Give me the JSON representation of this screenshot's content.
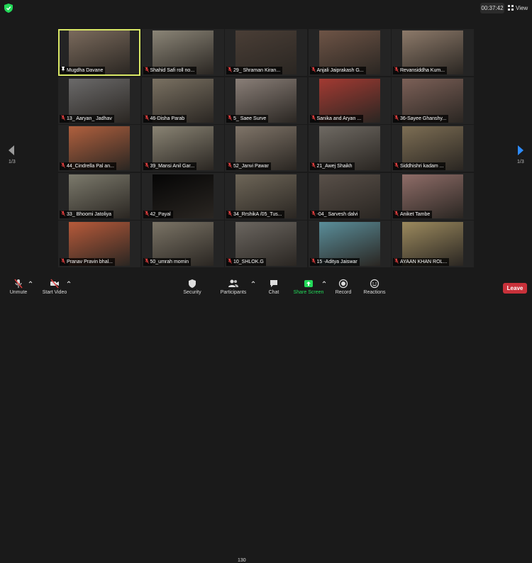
{
  "header": {
    "timer": "00:37:42",
    "view_label": "View"
  },
  "pagination": {
    "left": "1/3",
    "right": "1/3"
  },
  "participants": [
    {
      "name": "Mugdha Davane",
      "pinned": true,
      "active": true,
      "video": "#7a6a5c"
    },
    {
      "name": "Shahid Safi roll no...",
      "video": "#8b8577"
    },
    {
      "name": "29_ Shraman Kiran...",
      "video": "#4a3e36"
    },
    {
      "name": "Anjali Jaiprakash G...",
      "video": "#6e5446"
    },
    {
      "name": "Revansiddha Kum...",
      "video": "#8d7a6a"
    },
    {
      "name": "13_ Aaryan_ Jadhav",
      "video": "#6b6a6a"
    },
    {
      "name": "46-Disha Parab",
      "video": "#7a7162"
    },
    {
      "name": "5_ Saee Surve",
      "video": "#8a7f78"
    },
    {
      "name": "Sanika and  Aryan ...",
      "video": "#a33a32"
    },
    {
      "name": "36-Sayee Ghanshy...",
      "video": "#7c6057"
    },
    {
      "name": "44_Cindrella Pal an...",
      "video": "#b0603e"
    },
    {
      "name": "39_Mansi Anil  Gar...",
      "video": "#8a8474"
    },
    {
      "name": "52_Janvi Pawar",
      "video": "#807569"
    },
    {
      "name": "21_Awej Shaikh",
      "video": "#6f6a63"
    },
    {
      "name": "Siddhishri kadam ...",
      "video": "#7d6e54"
    },
    {
      "name": "33_ Bhoomi Jatoliya",
      "video": "#7c7a6c"
    },
    {
      "name": "42_Payal",
      "video": "#050505"
    },
    {
      "name": "34_RrshikA /05_Tus...",
      "video": "#6e6658"
    },
    {
      "name": "-04_ Sarvesh dalvi",
      "video": "#595049"
    },
    {
      "name": "Aniket Tambe",
      "video": "#8f6d68"
    },
    {
      "name": "Pranav Pravin bhal...",
      "video": "#b75a3a"
    },
    {
      "name": "50_umrah momin",
      "video": "#7b7466"
    },
    {
      "name": "10_SHLOK.G",
      "video": "#6b6660"
    },
    {
      "name": "15 -Aditya Jaiswar",
      "video": "#5a8e9a"
    },
    {
      "name": "AYAAN KHAN ROL...",
      "video": "#9c8a5e"
    }
  ],
  "toolbar": {
    "unmute": "Unmute",
    "start_video": "Start Video",
    "security": "Security",
    "participants": "Participants",
    "participant_count": "130",
    "chat": "Chat",
    "share_screen": "Share Screen",
    "record": "Record",
    "reactions": "Reactions",
    "leave": "Leave"
  },
  "colors": {
    "accent_green": "#23d959",
    "leave_red": "#c8313a",
    "active_outline": "#d9e866",
    "arrow_blue": "#2d8cff"
  }
}
